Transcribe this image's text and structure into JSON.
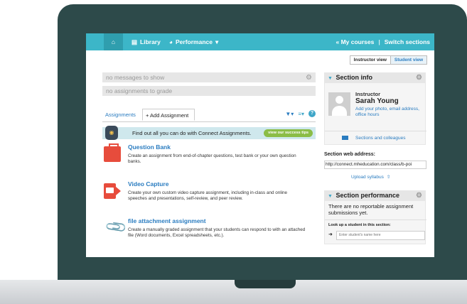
{
  "nav": {
    "library_label": "Library",
    "performance_label": "Performance",
    "my_courses_label": "« My courses",
    "separator": "|",
    "switch_sections_label": "Switch sections"
  },
  "view_toggle": {
    "instructor_label": "Instructor view",
    "student_label": "Student view"
  },
  "messages": {
    "messages_text": "no messages to show",
    "grade_text": "no assignments to grade"
  },
  "tabs": {
    "assignments_label": "Assignments",
    "add_assignment_label": "+ Add Assignment"
  },
  "banner": {
    "text": "Find out all you can do with Connect Assignments.",
    "button_label": "view our success tips"
  },
  "options": [
    {
      "title": "Question Bank",
      "description": "Create an assignment from end-of-chapter questions, test bank or your own question banks.",
      "icon": "toolbox-icon"
    },
    {
      "title": "Video Capture",
      "description": "Create your own custom video capture assignment, including in-class and online speeches and presentations, self-review, and peer review.",
      "icon": "video-camera-icon"
    },
    {
      "title": "file attachment assignment",
      "description": "Create a manually graded assignment that your students can respond to with an attached file (Word documents, Excel spreadsheets, etc.).",
      "icon": "paperclip-icon"
    }
  ],
  "section_info": {
    "title": "Section info",
    "instructor_label": "Instructor",
    "instructor_name": "Sarah Young",
    "add_photo_link": "Add your photo, email address, office hours",
    "colleagues_link": "Sections and colleagues",
    "web_address_label": "Section web address:",
    "web_address_value": "http://connect.mheducation.com/class/b-poi",
    "upload_label": "Upload syllabus"
  },
  "section_performance": {
    "title": "Section performance",
    "message": "There are no reportable assignment submissions yet.",
    "lookup_label": "Look up a student in this section:",
    "lookup_placeholder": "Enter student's name here"
  },
  "colors": {
    "navbar": "#3cb6c8",
    "link": "#2a7cc0",
    "laptop_frame": "#2d4a4a",
    "accent_red": "#e74c3c",
    "button_green": "#8bbd47"
  }
}
